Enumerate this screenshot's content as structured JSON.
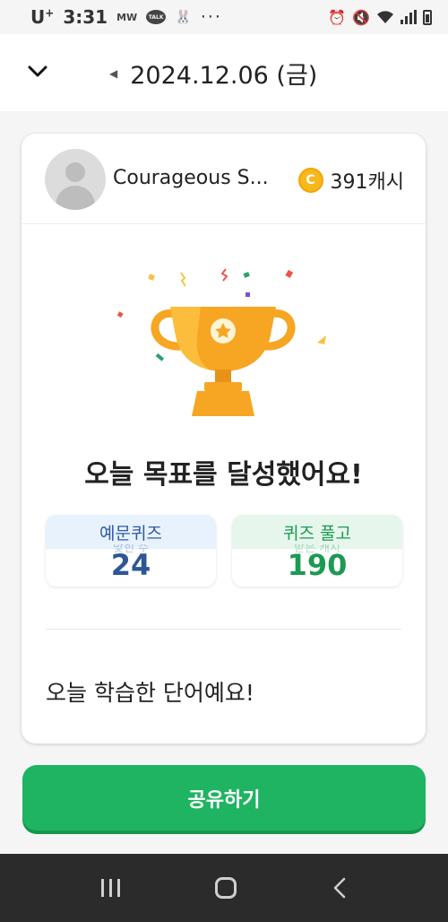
{
  "status_bar": {
    "carrier": "U",
    "carrier_sup": "+",
    "time": "3:31",
    "icons": [
      "mw-icon",
      "talk-icon",
      "rabbit-icon",
      "more-dots-icon",
      "alarm-icon",
      "mute-icon",
      "wifi-icon",
      "signal-icon",
      "battery-icon"
    ],
    "mw_label": "MW",
    "talk_label": "TALK",
    "dots": "···"
  },
  "header": {
    "date": "2024.12.06 (금)"
  },
  "profile": {
    "username": "Courageous S...",
    "cash": "391캐시"
  },
  "goal": {
    "title": "오늘 목표를 달성했어요!"
  },
  "stats": [
    {
      "label": "예문퀴즈",
      "sublabel": "맞힌 수",
      "value": "24"
    },
    {
      "label": "퀴즈 풀고",
      "sublabel": "받은 캐시",
      "value": "190"
    }
  ],
  "learned": {
    "title": "오늘 학습한 단어예요!"
  },
  "share_button": {
    "label": "공유하기"
  },
  "colors": {
    "accent_green": "#1fb462",
    "stat_blue": "#2d5796",
    "stat_green": "#1c9a52",
    "trophy_gold": "#f6a623"
  }
}
